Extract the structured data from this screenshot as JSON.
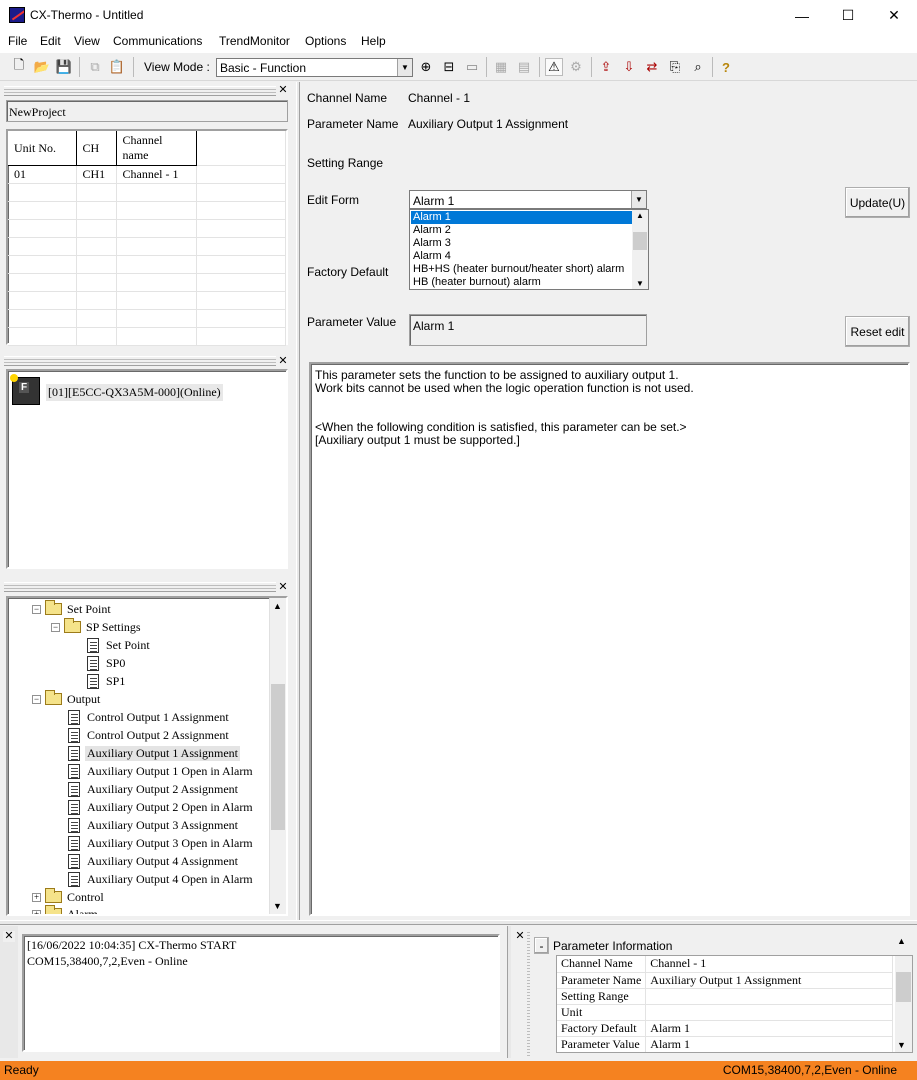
{
  "app": {
    "title": "CX-Thermo - Untitled"
  },
  "window": {
    "minimize": "—",
    "maximize": "☐",
    "close": "✕"
  },
  "menu": [
    "File",
    "Edit",
    "View",
    "Communications",
    "TrendMonitor",
    "Options",
    "Help"
  ],
  "toolbar": {
    "view_mode_label": "View Mode :",
    "view_mode_value": "Basic - Function"
  },
  "project": {
    "name": "NewProject"
  },
  "unit_table": {
    "headers": [
      "Unit No.",
      "CH",
      "Channel name"
    ],
    "rows": [
      [
        "01",
        "CH1",
        "Channel - 1"
      ]
    ]
  },
  "device": {
    "label": "[01][E5CC-QX3A5M-000](Online)"
  },
  "tree": {
    "set_point": "Set Point",
    "sp_settings": "SP Settings",
    "sp_set_point": "Set Point",
    "sp0": "SP0",
    "sp1": "SP1",
    "output": "Output",
    "items": [
      "Control Output 1 Assignment",
      "Control Output 2 Assignment",
      "Auxiliary Output 1 Assignment",
      "Auxiliary Output 1 Open in Alarm",
      "Auxiliary Output 2 Assignment",
      "Auxiliary Output 2 Open in Alarm",
      "Auxiliary Output 3 Assignment",
      "Auxiliary Output 3 Open in Alarm",
      "Auxiliary Output 4 Assignment",
      "Auxiliary Output 4 Open in Alarm"
    ],
    "control": "Control",
    "alarm": "Alarm"
  },
  "detail": {
    "channel_name_label": "Channel Name",
    "channel_name_value": "Channel - 1",
    "parameter_name_label": "Parameter Name",
    "parameter_name_value": "Auxiliary Output 1 Assignment",
    "setting_range_label": "Setting Range",
    "edit_form_label": "Edit Form",
    "edit_form_value": "Alarm 1",
    "edit_options": [
      "Alarm 1",
      "Alarm 2",
      "Alarm 3",
      "Alarm 4",
      "HB+HS (heater burnout/heater short) alarm",
      "HB (heater burnout) alarm"
    ],
    "factory_default_label": "Factory Default",
    "parameter_value_label": "Parameter Value",
    "parameter_value": "Alarm 1",
    "update_button": "Update(U)",
    "reset_button": "Reset edit",
    "description": [
      "This parameter sets the function to be assigned to auxiliary output 1.",
      "Work bits cannot be used when the logic operation function is not used.",
      "",
      "<When the following condition is satisfied, this parameter can be set.>",
      "[Auxiliary output 1 must be supported.]"
    ]
  },
  "log": {
    "lines": [
      "[16/06/2022 10:04:35] CX-Thermo START",
      "COM15,38400,7,2,Even - Online"
    ]
  },
  "param_info": {
    "title": "Parameter Information",
    "collapse": "-",
    "rows": [
      [
        "Channel Name",
        "Channel - 1"
      ],
      [
        "Parameter Name",
        "Auxiliary Output 1 Assignment"
      ],
      [
        "Setting Range",
        ""
      ],
      [
        "Unit",
        ""
      ],
      [
        "Factory Default",
        "Alarm 1"
      ],
      [
        "Parameter Value",
        "Alarm 1"
      ]
    ]
  },
  "status": {
    "left": "Ready",
    "right": "COM15,38400,7,2,Even - Online"
  }
}
